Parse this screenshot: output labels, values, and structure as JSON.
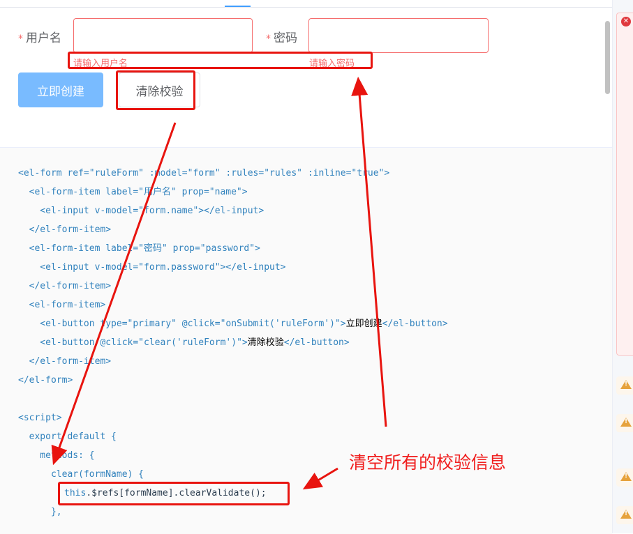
{
  "form": {
    "required_mark": "*",
    "username_label": "用户名",
    "password_label": "密码",
    "username_value": "",
    "password_value": "",
    "username_error": "请输入用户名",
    "password_error": "请输入密码",
    "submit_label": "立即创建",
    "clear_label": "清除校验"
  },
  "code_lines": [
    "<el-form ref=\"ruleForm\" :model=\"form\" :rules=\"rules\" :inline=\"true\">",
    "  <el-form-item label=\"用户名\" prop=\"name\">",
    "    <el-input v-model=\"form.name\"></el-input>",
    "  </el-form-item>",
    "  <el-form-item label=\"密码\" prop=\"password\">",
    "    <el-input v-model=\"form.password\"></el-input>",
    "  </el-form-item>",
    "  <el-form-item>",
    "    <el-button type=\"primary\" @click=\"onSubmit('ruleForm')\">",
    "立即创建",
    "</el-button>",
    "    <el-button @click=\"clear('ruleForm')\">",
    "清除校验",
    "</el-button>",
    "  </el-form-item>",
    "</el-form>",
    "<script>",
    "  export default {",
    "    methods: {",
    "      clear(formName) {",
    "this",
    ".$refs[formName].clearValidate();",
    "      },"
  ],
  "annotation": {
    "text": "清空所有的校验信息"
  },
  "colors": {
    "annotation_red": "#e8140f",
    "code_blue": "#3182bd",
    "primary": "#409eff",
    "error": "#f56c6c"
  },
  "icons": {
    "error": "circle-x-icon",
    "warning": "warning-triangle-icon"
  }
}
